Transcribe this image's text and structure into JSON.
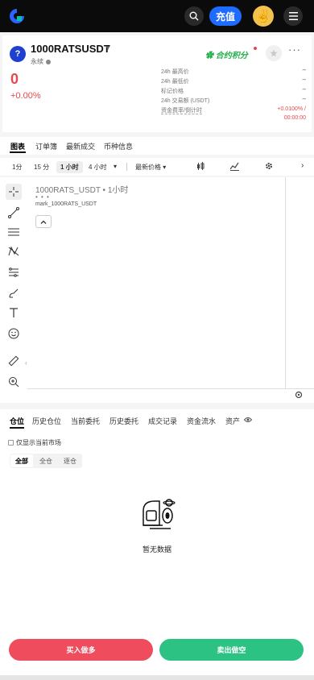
{
  "header": {
    "deposit_label": "充值",
    "avatar_emoji": "✌"
  },
  "ticker": {
    "icon_text": "?",
    "symbol": "1000RATSUSDT",
    "type_label": "永续",
    "price": "0",
    "change": "+0.00%",
    "points_label": "合约积分",
    "stats": [
      {
        "label": "24h 最高价",
        "value": "--"
      },
      {
        "label": "24h 最低价",
        "value": "--"
      },
      {
        "label": "标记价格",
        "value": "--"
      },
      {
        "label": "24h 交易额 (USDT)",
        "value": "--"
      },
      {
        "label": "资金费率/倒计时",
        "value": "+0.0100% /",
        "value2": "00:00:00"
      }
    ]
  },
  "main_tabs": [
    "图表",
    "订单簿",
    "最新成交",
    "币种信息"
  ],
  "chart_toolbar": {
    "intervals": [
      "1分",
      "15 分",
      "1 小时",
      "4 小时"
    ],
    "price_type": "最新价格"
  },
  "chart": {
    "title": "1000RATS_USDT • 1小时",
    "dots": "• • •",
    "mark_label": "mark_1000RATS_USDT"
  },
  "positions": {
    "tabs": [
      "仓位",
      "历史仓位",
      "当前委托",
      "历史委托",
      "成交记录",
      "资金流水",
      "资产"
    ],
    "checkbox_label": "仅显示当前市场",
    "modes": [
      "全部",
      "全仓",
      "逐仓"
    ],
    "empty_text": "暂无数据"
  },
  "actions": {
    "buy_label": "买入做多",
    "sell_label": "卖出做空"
  },
  "colors": {
    "accent": "#1e6bff",
    "down": "#e5484d",
    "up": "#2bc283",
    "buy": "#ef4d5d",
    "points": "#22b14c"
  }
}
